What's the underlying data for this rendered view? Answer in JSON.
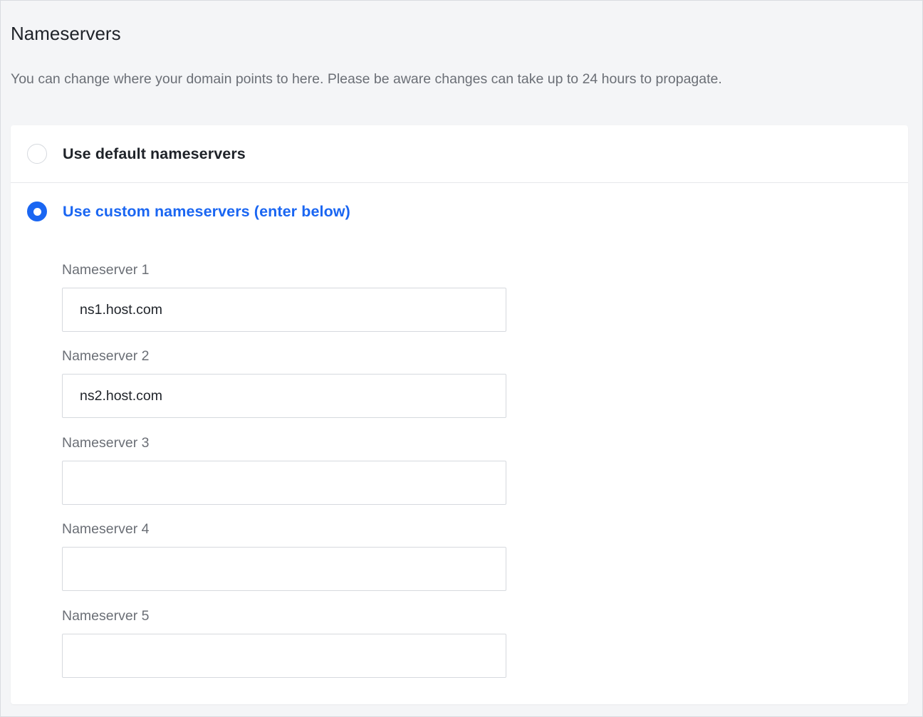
{
  "section": {
    "title": "Nameservers",
    "description": "You can change where your domain points to here. Please be aware changes can take up to 24 hours to propagate."
  },
  "options": {
    "default_label": "Use default nameservers",
    "default_selected": false,
    "custom_label": "Use custom nameservers (enter below)",
    "custom_selected": true
  },
  "fields": [
    {
      "label": "Nameserver 1",
      "value": "ns1.host.com",
      "placeholder": ""
    },
    {
      "label": "Nameserver 2",
      "value": "ns2.host.com",
      "placeholder": ""
    },
    {
      "label": "Nameserver 3",
      "value": "",
      "placeholder": ""
    },
    {
      "label": "Nameserver 4",
      "value": "",
      "placeholder": ""
    },
    {
      "label": "Nameserver 5",
      "value": "",
      "placeholder": ""
    }
  ],
  "colors": {
    "accent": "#1a66f2",
    "text_primary": "#1f2329",
    "text_muted": "#6b6f76",
    "page_background": "#f4f5f7",
    "border": "#d6d9de"
  }
}
